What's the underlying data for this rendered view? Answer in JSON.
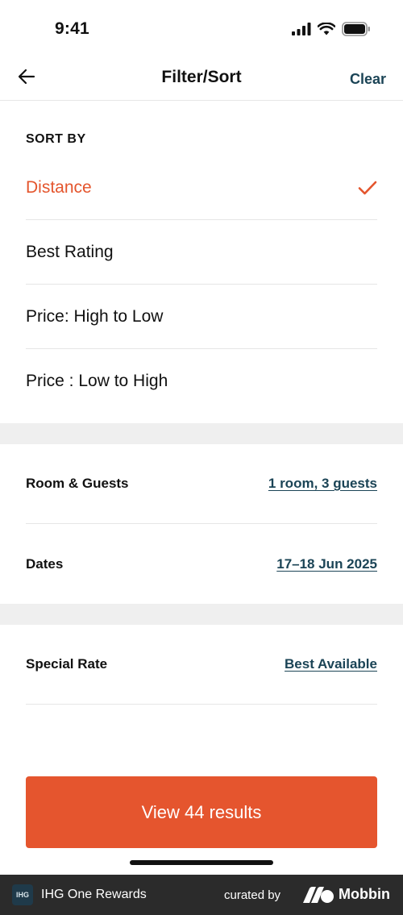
{
  "status_bar": {
    "time": "9:41"
  },
  "nav": {
    "title": "Filter/Sort",
    "clear_label": "Clear"
  },
  "sort": {
    "header": "SORT BY",
    "items": [
      {
        "label": "Distance",
        "selected": true
      },
      {
        "label": "Best Rating",
        "selected": false
      },
      {
        "label": "Price: High to Low",
        "selected": false
      },
      {
        "label": "Price : Low to High",
        "selected": false
      }
    ]
  },
  "room_guests": {
    "label": "Room & Guests",
    "value": "1 room, 3 guests"
  },
  "dates": {
    "label": "Dates",
    "value": "17–18 Jun 2025"
  },
  "special_rate": {
    "label": "Special Rate",
    "value": "Best Available"
  },
  "results_button": {
    "label": "View 44 results"
  },
  "footer": {
    "logo_text": "IHG",
    "app_name": "IHG One Rewards",
    "curated_by": "curated by",
    "brand": "Mobbin"
  },
  "colors": {
    "accent": "#e4552d",
    "link": "#1b4456",
    "band": "#efefef"
  }
}
